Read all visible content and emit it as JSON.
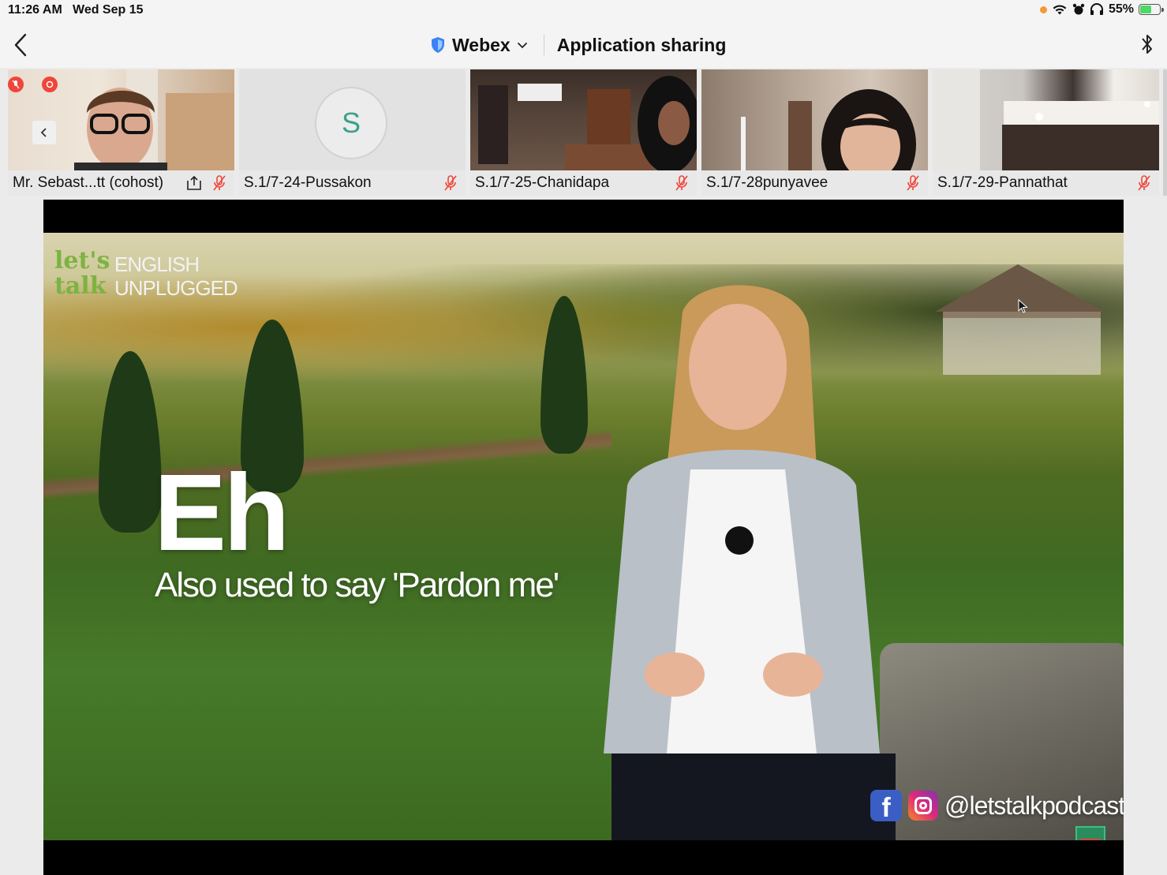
{
  "status_bar": {
    "time": "11:26 AM",
    "date": "Wed Sep 15",
    "battery_percent": "55%",
    "battery_level": 0.55,
    "icons": [
      "recording-dot-icon",
      "wifi-icon",
      "alarm-icon",
      "headphones-icon",
      "battery-charging-icon"
    ]
  },
  "nav": {
    "back_icon": "chevron-left-icon",
    "app_name": "Webex",
    "app_menu_icon": "chevron-down-icon",
    "title": "Application sharing",
    "bluetooth_icon": "bluetooth-icon"
  },
  "participants": [
    {
      "name": "Mr. Sebast...tt (cohost)",
      "sharing": true,
      "muted": true,
      "has_video": true
    },
    {
      "name": "S.1/7-24-Pussakon",
      "avatar_letter": "S",
      "muted": true,
      "has_video": false
    },
    {
      "name": "S.1/7-25-Chanidapa",
      "muted": true,
      "has_video": true
    },
    {
      "name": "S.1/7-28punyavee",
      "muted": true,
      "has_video": true
    },
    {
      "name": "S.1/7-29-Pannathat",
      "muted": true,
      "has_video": true
    }
  ],
  "shared_content": {
    "logo_line1_a": "let's",
    "logo_line2_a": "talk",
    "logo_line1_b": "ENGLISH",
    "logo_line2_b": "UNPLUGGED",
    "word": "Eh",
    "meaning": "Also used to say 'Pardon me'",
    "social_handle": "@letstalkpodcast",
    "facebook_glyph": "f"
  },
  "colors": {
    "accent_red": "#f0453a",
    "avatar_letter": "#3aa18b",
    "webex_shield": "#3b82f6",
    "battery_green": "#4cd964",
    "recording_orange": "#f29a36"
  }
}
